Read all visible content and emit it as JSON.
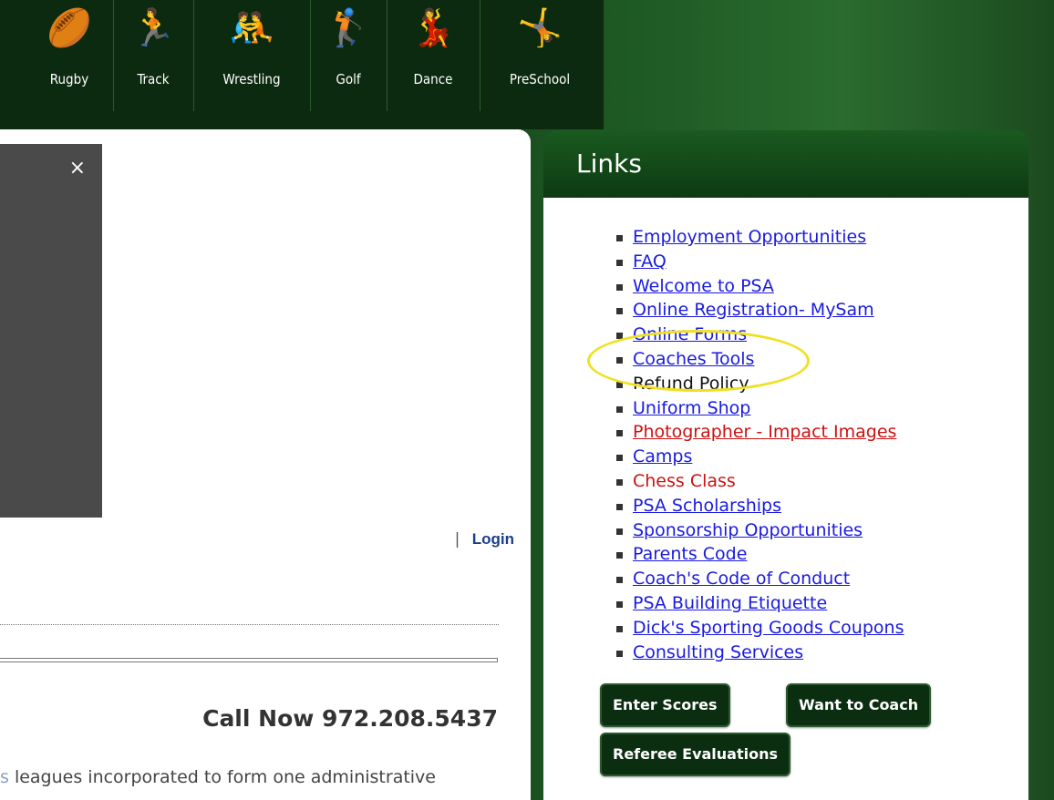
{
  "sports": [
    {
      "label": "Rugby",
      "icon": "rugby-player-icon",
      "glyph": "🏉"
    },
    {
      "label": "Track",
      "icon": "runner-icon",
      "glyph": "🏃"
    },
    {
      "label": "Wrestling",
      "icon": "wrestlers-icon",
      "glyph": "🤼"
    },
    {
      "label": "Golf",
      "icon": "golfer-icon",
      "glyph": "🏌"
    },
    {
      "label": "Dance",
      "icon": "dancer-icon",
      "glyph": "💃"
    },
    {
      "label": "PreSchool",
      "icon": "preschool-icon",
      "glyph": "🤸"
    }
  ],
  "main": {
    "close_glyph": "×",
    "separator": "|",
    "login_label": "Login",
    "call_now": "Call Now  972.208.5437",
    "intro_prefix": "s",
    "intro_text": " leagues incorporated to form one administrative"
  },
  "links": {
    "title": "Links",
    "items": [
      {
        "label": "Employment Opportunities"
      },
      {
        "label": "FAQ"
      },
      {
        "label": "Welcome to PSA"
      },
      {
        "label": "Online Registration- MySam"
      },
      {
        "label": "Online Forms"
      },
      {
        "label": "Coaches Tools"
      },
      {
        "label": "Refund Policy"
      },
      {
        "label": "Uniform Shop"
      },
      {
        "label": "Photographer - Impact Images"
      },
      {
        "label": "Camps"
      },
      {
        "label": "Chess Class"
      },
      {
        "label": "PSA Scholarships"
      },
      {
        "label": "Sponsorship Opportunities"
      },
      {
        "label": "Parents Code"
      },
      {
        "label": "Coach's Code of Conduct"
      },
      {
        "label": "PSA Building Etiquette"
      },
      {
        "label": "Dick's Sporting Goods Coupons"
      },
      {
        "label": "Consulting Services"
      }
    ],
    "buttons": {
      "enter_scores": "Enter Scores",
      "want_to_coach": "Want to Coach",
      "referee_evaluations": "Referee Evaluations"
    }
  },
  "colors": {
    "link_blue": "#1a1ae0",
    "link_red": "#cc1111",
    "highlight": "#f0e020",
    "brand_green": "#0b2e10"
  }
}
